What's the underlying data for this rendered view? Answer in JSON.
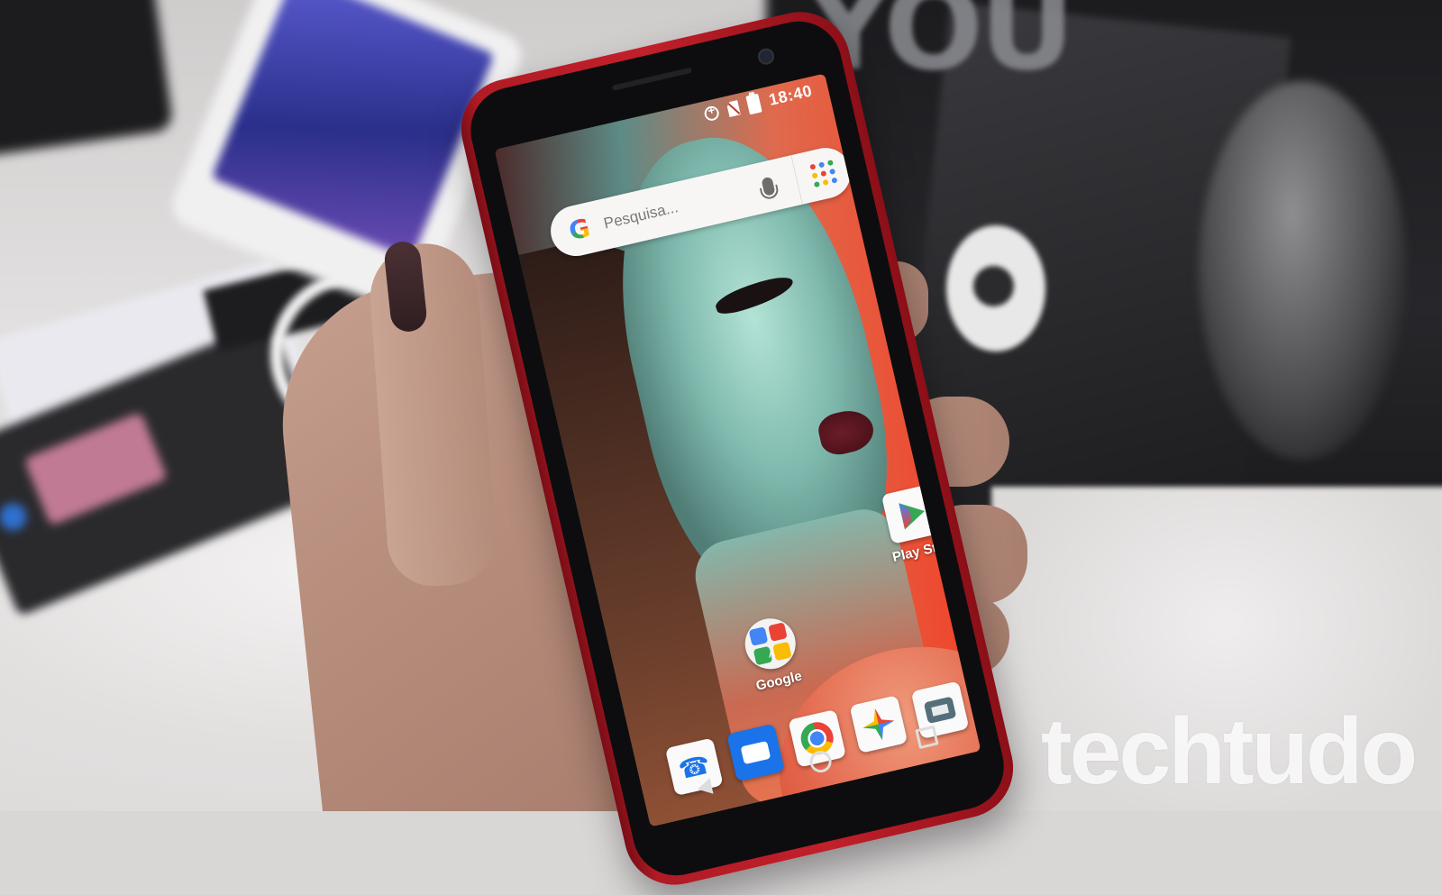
{
  "status_bar": {
    "time": "18:40"
  },
  "search_widget": {
    "placeholder": "Pesquisa..."
  },
  "home_apps": [
    {
      "label": "Play St..."
    },
    {
      "label": "Google"
    }
  ],
  "dock_icons": [
    "phone-icon",
    "messages-icon",
    "chrome-icon",
    "photos-icon",
    "camera-icon"
  ],
  "watermark": {
    "text": "techtudo"
  },
  "colors": {
    "phone_body": "#c2202b",
    "screen_accent": "#f0442a"
  }
}
